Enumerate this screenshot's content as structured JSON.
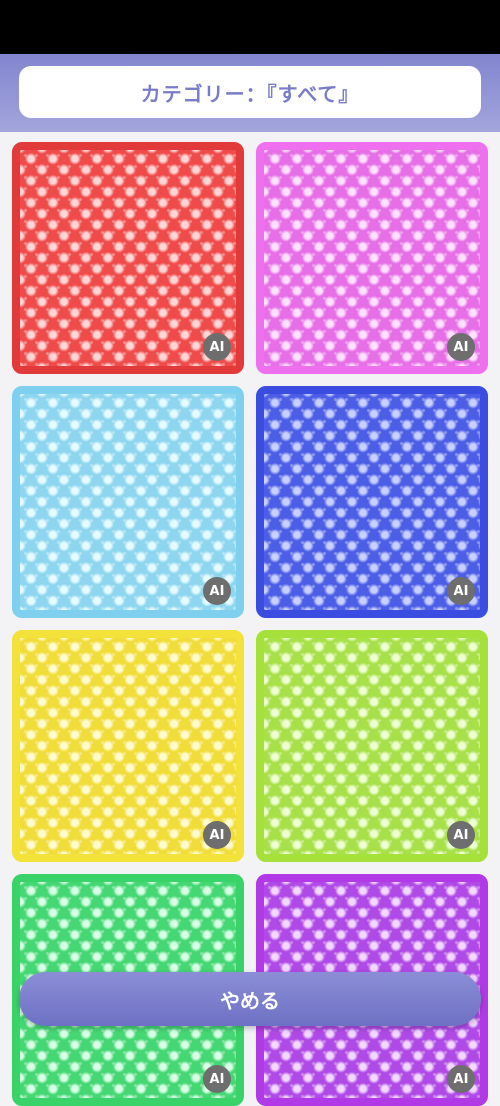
{
  "header": {
    "category_label": "カテゴリー：『すべて』"
  },
  "tiles": [
    {
      "name": "red-glitter-tile",
      "border": "#e23a3a",
      "base": "#ef4b4b",
      "light": "#ffd6d6",
      "ai": "AI"
    },
    {
      "name": "pink-glitter-tile",
      "border": "#ef70ef",
      "base": "#e66ee6",
      "light": "#ffe0ff",
      "ai": "AI"
    },
    {
      "name": "lightblue-glitter-tile",
      "border": "#7fd0ef",
      "base": "#8ed6ef",
      "light": "#e6fbff",
      "ai": "AI"
    },
    {
      "name": "blue-glitter-tile",
      "border": "#3b4de0",
      "base": "#4c5ee6",
      "light": "#c8d0ff",
      "ai": "AI"
    },
    {
      "name": "yellow-glitter-tile",
      "border": "#f2e23a",
      "base": "#f1dd3a",
      "light": "#fffbd0",
      "ai": "AI"
    },
    {
      "name": "lime-glitter-tile",
      "border": "#a6e03a",
      "base": "#a8e04a",
      "light": "#eeffd4",
      "ai": "AI"
    },
    {
      "name": "green-glitter-tile",
      "border": "#3ad36a",
      "base": "#45d774",
      "light": "#d8ffe6",
      "ai": "AI"
    },
    {
      "name": "purple-glitter-tile",
      "border": "#b23ae6",
      "base": "#b04ae6",
      "light": "#f2d8ff",
      "ai": "AI"
    }
  ],
  "footer": {
    "quit_label": "やめる"
  }
}
